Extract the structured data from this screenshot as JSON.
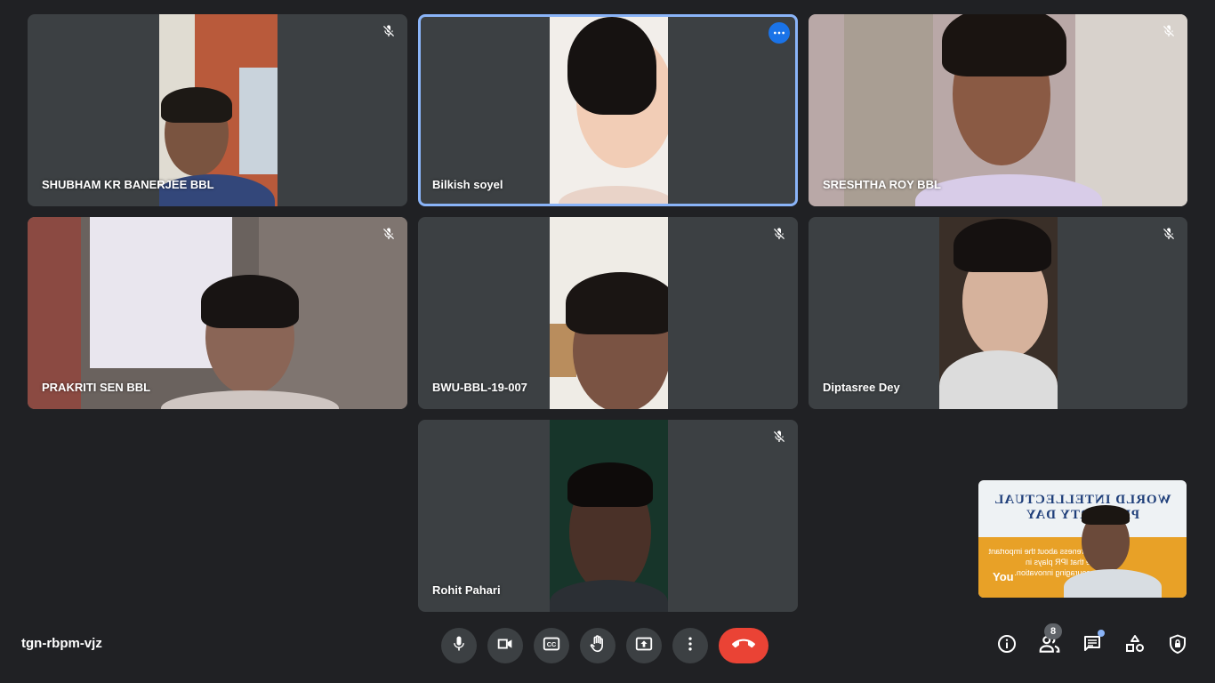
{
  "meeting": {
    "code": "tgn-rbpm-vjz",
    "participant_count": "8"
  },
  "participants": [
    {
      "name": "SHUBHAM KR BANERJEE BBL"
    },
    {
      "name": "Bilkish soyel"
    },
    {
      "name": "SRESHTHA ROY BBL"
    },
    {
      "name": "PRAKRITI SEN BBL"
    },
    {
      "name": "BWU-BBL-19-007"
    },
    {
      "name": "Diptasree Dey"
    },
    {
      "name": "Rohit Pahari"
    }
  ],
  "self_view": {
    "label": "You",
    "background_title": "WORLD INTELLECTUAL PROPERTY DAY",
    "background_text": "Awareness about the important role that IPR plays in encouraging innovation."
  },
  "controls": [
    {
      "name": "microphone",
      "icon": "mic-icon"
    },
    {
      "name": "camera",
      "icon": "videocam-icon"
    },
    {
      "name": "captions",
      "icon": "closed-caption-icon"
    },
    {
      "name": "raise-hand",
      "icon": "hand-icon"
    },
    {
      "name": "present",
      "icon": "present-screen-icon"
    },
    {
      "name": "more-options",
      "icon": "more-vert-icon"
    },
    {
      "name": "leave-call",
      "icon": "call-end-icon"
    }
  ],
  "side_controls": [
    {
      "name": "meeting-details",
      "icon": "info-icon"
    },
    {
      "name": "people",
      "icon": "people-icon"
    },
    {
      "name": "chat",
      "icon": "chat-icon"
    },
    {
      "name": "activities",
      "icon": "shapes-icon"
    },
    {
      "name": "host-controls",
      "icon": "shield-lock-icon"
    }
  ],
  "colors": {
    "background": "#202124",
    "tile": "#3c4043",
    "active_border": "#8ab4f8",
    "end_call": "#ea4335",
    "accent": "#1a73e8"
  }
}
